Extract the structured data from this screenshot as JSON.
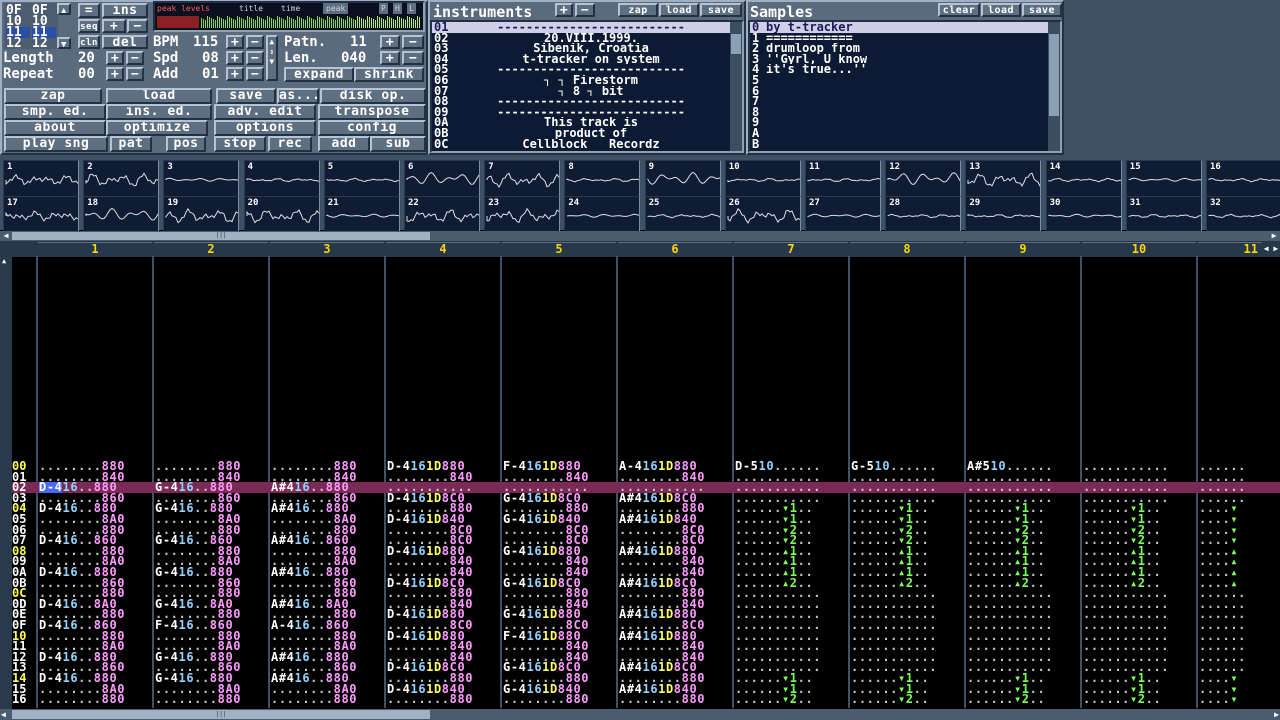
{
  "pos_grid": {
    "col_a": [
      "0F",
      "10",
      "11",
      "12"
    ],
    "col_b": [
      "0F",
      "10",
      "11",
      "12"
    ]
  },
  "song": {
    "length_label": "Length",
    "length": "20",
    "repeat_label": "Repeat",
    "repeat": "00",
    "bpm_label": "BPM",
    "bpm": "115",
    "spd_label": "Spd",
    "spd": "08",
    "add_label": "Add",
    "add": "01",
    "patn_label": "Patn.",
    "patn": "11",
    "len_label": "Len.",
    "len": "040"
  },
  "small_btns": {
    "eq": "=",
    "plus": "+",
    "minus": "−",
    "seq": "seq",
    "cln": "cln",
    "ins": "ins",
    "del": "del"
  },
  "toggles": {
    "expand": "expand",
    "shrink": "shrink"
  },
  "peak_tabs": [
    "peak levels",
    "title",
    "time",
    "peak"
  ],
  "icons": {
    "p": "P",
    "h": "H",
    "l": "L"
  },
  "main_buttons": [
    [
      "zap",
      "load",
      "save",
      "as...",
      "disk op."
    ],
    [
      "smp. ed.",
      "ins. ed.",
      "adv. edit",
      "transpose"
    ],
    [
      "about",
      "optimize",
      "options",
      "config"
    ],
    [
      "play sng",
      "pat",
      "pos",
      "stop",
      "rec",
      "add",
      "sub"
    ]
  ],
  "instruments": {
    "title": "instruments",
    "buttons": [
      "zap",
      "load",
      "save"
    ],
    "numbers": [
      "01",
      "02",
      "03",
      "04",
      "05",
      "06",
      "07",
      "08",
      "09",
      "0A",
      "0B",
      "0C"
    ],
    "names": [
      "--------------------------",
      "20.VIII.1999.",
      "Sibenik, Croatia",
      "t-tracker on system",
      "--------------------------",
      "┐ ┐ Firestorm",
      "┐ 8 ┐ bit",
      "--------------------------",
      "--------------------------",
      "This track is",
      "product of",
      "Cellblock   Recordz"
    ]
  },
  "samples": {
    "title": "Samples",
    "buttons": [
      "clear",
      "load",
      "save"
    ],
    "numbers": [
      "0",
      "1",
      "2",
      "3",
      "4",
      "5",
      "6",
      "7",
      "8",
      "9",
      "A",
      "B"
    ],
    "names": [
      "by t-tracker",
      "============",
      "drumloop from",
      "''Gyrl, U know",
      "it's true...''",
      "",
      "",
      "",
      "",
      "",
      "",
      ""
    ]
  },
  "scopes": [
    "1",
    "2",
    "3",
    "4",
    "5",
    "6",
    "7",
    "8",
    "9",
    "10",
    "11",
    "12",
    "13",
    "14",
    "15",
    "16",
    "17",
    "18",
    "19",
    "20",
    "21",
    "22",
    "23",
    "24",
    "25",
    "26",
    "27",
    "28",
    "29",
    "30",
    "31",
    "32"
  ],
  "channels": [
    "1",
    "2",
    "3",
    "4",
    "5",
    "6",
    "7",
    "8",
    "9",
    "10",
    "11"
  ],
  "pattern_rows": [
    "00",
    "01",
    "02",
    "03",
    "04",
    "05",
    "06",
    "07",
    "08",
    "09",
    "0A",
    "0B",
    "0C",
    "0D",
    "0E",
    "0F",
    "10",
    "11",
    "12",
    "13",
    "14",
    "15",
    "16"
  ],
  "current_row": "02",
  "pattern": [
    [
      "........880",
      "........880",
      "........880",
      "D-4161D880",
      "F-4161D880",
      "A-4161D880",
      "D-510......",
      "G-510......",
      "A#510......",
      "...........",
      "......"
    ],
    [
      "........840",
      "........840",
      "........840",
      "........840",
      "........840",
      "........840",
      "...........",
      "...........",
      "...........",
      "...........",
      "......"
    ],
    [
      "D-416..880",
      "G-416..880",
      "A#416..880",
      "...........",
      "...........",
      "...........",
      "...........",
      "...........",
      "...........",
      "...........",
      "......"
    ],
    [
      "........860",
      "........860",
      "........860",
      "D-4161D8C0",
      "G-4161D8C0",
      "A#4161D8C0",
      "...........",
      "...........",
      "...........",
      "...........",
      "......"
    ],
    [
      "D-416..880",
      "G-416..880",
      "A#416..880",
      "........880",
      "........880",
      "........880",
      "......▾1..",
      "......▾1..",
      "......▾1..",
      "......▾1..",
      "....▾"
    ],
    [
      "........8A0",
      "........8A0",
      "........8A0",
      "D-4161D840",
      "G-4161D840",
      "A#4161D840",
      "......▾1..",
      "......▾1..",
      "......▾1..",
      "......▾1..",
      "....▾"
    ],
    [
      "........880",
      "........880",
      "........880",
      "........8C0",
      "........8C0",
      "........8C0",
      "......▾2..",
      "......▾2..",
      "......▾2..",
      "......▾2..",
      "....▾"
    ],
    [
      "D-416..860",
      "G-416..860",
      "A#416..860",
      "........8C0",
      "........8C0",
      "........8C0",
      "......▾2..",
      "......▾2..",
      "......▾2..",
      "......▾2..",
      "....▾"
    ],
    [
      "........880",
      "........880",
      "........880",
      "D-4161D880",
      "G-4161D880",
      "A#4161D880",
      "......▴1..",
      "......▴1..",
      "......▴1..",
      "......▴1..",
      "....▴"
    ],
    [
      "........8A0",
      "........8A0",
      "........8A0",
      "........840",
      "........840",
      "........840",
      "......▴1..",
      "......▴1..",
      "......▴1..",
      "......▴1..",
      "....▴"
    ],
    [
      "D-416..880",
      "G-416..880",
      "A#416..880",
      "........840",
      "........840",
      "........840",
      "......▴1..",
      "......▴1..",
      "......▴1..",
      "......▴1..",
      "....▴"
    ],
    [
      "........860",
      "........860",
      "........860",
      "D-4161D8C0",
      "G-4161D8C0",
      "A#4161D8C0",
      "......▴2..",
      "......▴2..",
      "......▴2..",
      "......▴2..",
      "....▴"
    ],
    [
      "........880",
      "........880",
      "........880",
      "........880",
      "........880",
      "........880",
      "...........",
      "...........",
      "...........",
      "...........",
      "......"
    ],
    [
      "D-416..8A0",
      "G-416..8A0",
      "A#416..8A0",
      "........840",
      "........840",
      "........840",
      "...........",
      "...........",
      "...........",
      "...........",
      "......"
    ],
    [
      "........880",
      "........880",
      "........880",
      "D-4161D880",
      "G-4161D880",
      "A#4161D880",
      "...........",
      "...........",
      "...........",
      "...........",
      "......"
    ],
    [
      "D-416..860",
      "F-416..860",
      "A-416..860",
      "........8C0",
      "........8C0",
      "........8C0",
      "...........",
      "...........",
      "...........",
      "...........",
      "......"
    ],
    [
      "........880",
      "........880",
      "........880",
      "D-4161D880",
      "F-4161D880",
      "A#4161D880",
      "...........",
      "...........",
      "...........",
      "...........",
      "......"
    ],
    [
      "........8A0",
      "........8A0",
      "........8A0",
      "........840",
      "........840",
      "........840",
      "...........",
      "...........",
      "...........",
      "...........",
      "......"
    ],
    [
      "D-416..880",
      "G-416..880",
      "A#416..880",
      "........840",
      "........840",
      "........840",
      "...........",
      "...........",
      "...........",
      "...........",
      "......"
    ],
    [
      "........860",
      "........860",
      "........860",
      "D-4161D8C0",
      "G-4161D8C0",
      "A#4161D8C0",
      "...........",
      "...........",
      "...........",
      "...........",
      "......"
    ],
    [
      "D-416..880",
      "G-416..880",
      "A#416..880",
      "........880",
      "........880",
      "........880",
      "......▾1..",
      "......▾1..",
      "......▾1..",
      "......▾1..",
      "....▾"
    ],
    [
      "........8A0",
      "........8A0",
      "........8A0",
      "D-4161D840",
      "G-4161D840",
      "A#4161D840",
      "......▾1..",
      "......▾1..",
      "......▾1..",
      "......▾1..",
      "....▾"
    ],
    [
      "........880",
      "........880",
      "........880",
      "........880",
      "........880",
      "........880",
      "......▾2..",
      "......▾2..",
      "......▾2..",
      "......▾2..",
      "....▾"
    ]
  ],
  "colors": {
    "note": "#ffffff",
    "instr": "#8fd4ff",
    "vol": "#ff9aff",
    "fx": "#ffff66",
    "dot": "#bfc8d0",
    "cursor_row": "#7a2a55",
    "arrow": "#7cff5a",
    "rownum_hi": "#ffff55",
    "rownum": "#ffffff"
  }
}
